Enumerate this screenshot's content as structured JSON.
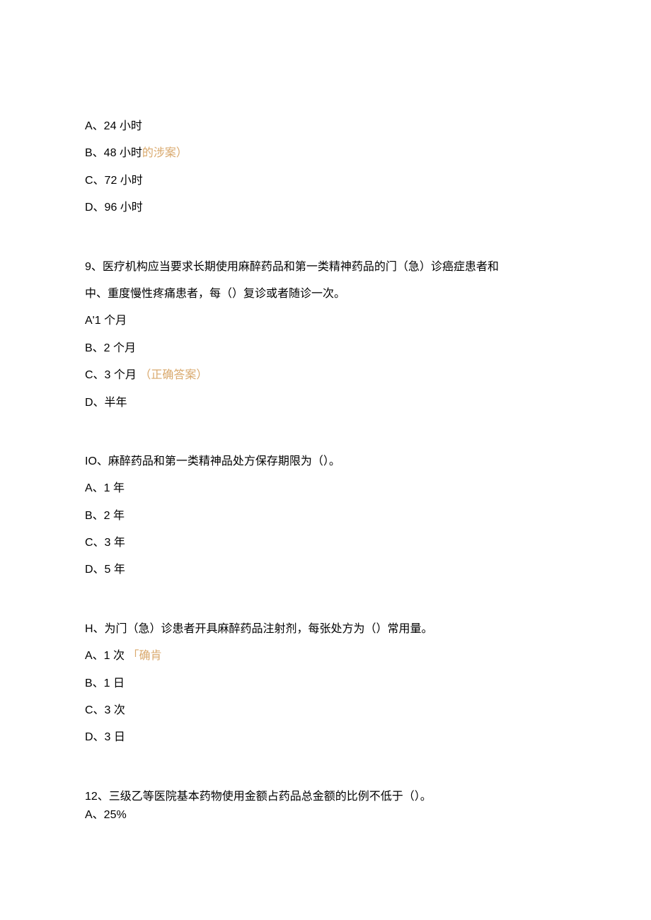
{
  "q8": {
    "optA": "A、24 小时",
    "optB_pre": "B、48 小时",
    "optB_ann": "的涉案）",
    "optC": "C、72 小时",
    "optD": "D、96 小时"
  },
  "q9": {
    "stem_line1": "9、医疗机构应当要求长期使用麻醉药品和第一类精神药品的门（急）诊癌症患者和",
    "stem_line2": "中、重度慢性疼痛患者，每（）复诊或者随诊一次。",
    "optA": "A'1 个月",
    "optB": "B、2 个月",
    "optC_pre": "C、3 个月",
    "optC_ann": "（正确答案）",
    "optD": "D、半年"
  },
  "q10": {
    "stem": "IO、麻醉药品和第一类精神品处方保存期限为（）。",
    "optA": "A、1 年",
    "optB": "B、2 年",
    "optC": "C、3 年",
    "optD": "D、5 年"
  },
  "q11": {
    "stem": "H、为门（急）诊患者开具麻醉药品注射剂，每张处方为（）常用量。",
    "optA_pre": "A、1 次",
    "optA_ann": "「确肯",
    "optB": "B、1 日",
    "optC": "C、3 次",
    "optD": "D、3 日"
  },
  "q12": {
    "stem": "12、三级乙等医院基本药物使用金额占药品总金额的比例不低于（）。",
    "optA": "A、25%"
  }
}
